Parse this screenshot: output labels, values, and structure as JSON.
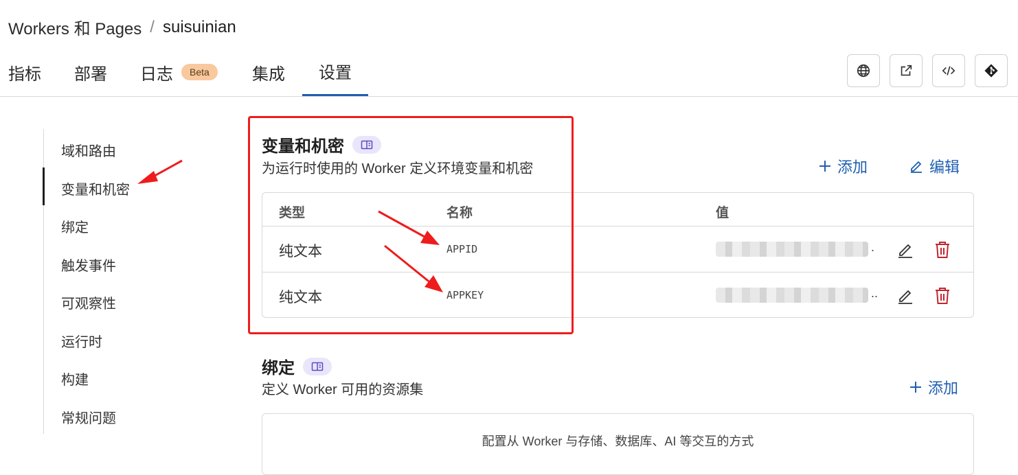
{
  "breadcrumb": {
    "root": "Workers 和 Pages",
    "separator": "/",
    "current": "suisuinian"
  },
  "tabs": [
    {
      "label": "指标"
    },
    {
      "label": "部署"
    },
    {
      "label": "日志",
      "badge": "Beta"
    },
    {
      "label": "集成"
    },
    {
      "label": "设置",
      "active": true
    }
  ],
  "toolbar_icons": [
    "globe-icon",
    "external-link-icon",
    "code-icon",
    "git-icon"
  ],
  "sidebar": {
    "items": [
      {
        "label": "域和路由"
      },
      {
        "label": "变量和机密",
        "active": true
      },
      {
        "label": "绑定"
      },
      {
        "label": "触发事件"
      },
      {
        "label": "可观察性"
      },
      {
        "label": "运行时"
      },
      {
        "label": "构建"
      },
      {
        "label": "常规问题"
      }
    ]
  },
  "variables": {
    "title": "变量和机密",
    "description": "为运行时使用的 Worker 定义环境变量和机密",
    "add_label": "添加",
    "edit_label": "编辑",
    "columns": {
      "type": "类型",
      "name": "名称",
      "value": "值"
    },
    "rows": [
      {
        "type": "纯文本",
        "name": "APPID",
        "value_suffix": "."
      },
      {
        "type": "纯文本",
        "name": "APPKEY",
        "value_suffix": ".."
      }
    ]
  },
  "bindings": {
    "title": "绑定",
    "description": "定义 Worker 可用的资源集",
    "add_label": "添加",
    "empty_text": "配置从 Worker 与存储、数据库、AI 等交互的方式"
  },
  "colors": {
    "accent": "#1f5fb0",
    "delete": "#c0262d",
    "annotation": "#ee1c1c",
    "beta_badge": "#f8c99e"
  }
}
